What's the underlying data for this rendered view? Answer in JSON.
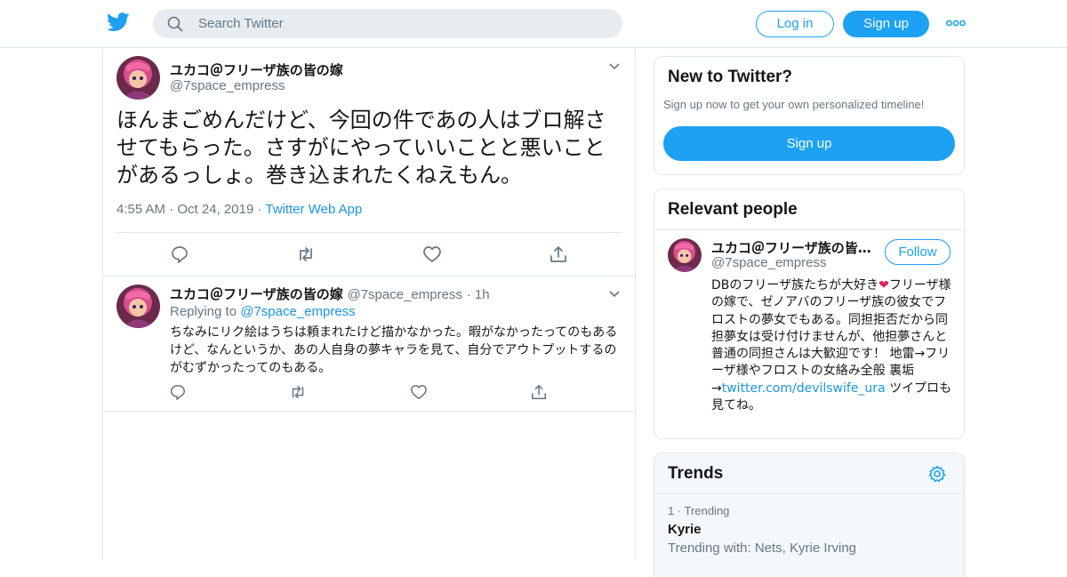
{
  "colors": {
    "accent": "#1da1f2",
    "link": "#1b95e0",
    "secondary_text": "#657786",
    "border": "#e1e8ed"
  },
  "header": {
    "search_placeholder": "Search Twitter",
    "login_label": "Log in",
    "signup_label": "Sign up"
  },
  "main_tweet": {
    "name": "ユカコ＠フリーザ族の皆の嫁",
    "handle": "@7space_empress",
    "text": "ほんまごめんだけど、今回の件であの人はブロ解させてもらった。さすがにやっていいことと悪いことがあるっしょ。巻き込まれたくねえもん。",
    "time": "4:55 AM",
    "date": "Oct 24, 2019",
    "source": "Twitter Web App"
  },
  "reply_tweet": {
    "name": "ユカコ＠フリーザ族の皆の嫁",
    "handle": "@7space_empress",
    "time": "1h",
    "replying_label": "Replying to",
    "replying_to": "@7space_empress",
    "text": "ちなみにリク絵はうちは頼まれたけど描かなかった。暇がなかったってのもあるけど、なんというか、あの人自身の夢キャラを見て、自分でアウトプットするのがむずかったってのもある。"
  },
  "new_to_twitter": {
    "title": "New to Twitter?",
    "subtitle": "Sign up now to get your own personalized timeline!",
    "button": "Sign up"
  },
  "relevant_people": {
    "title": "Relevant people",
    "person": {
      "name": "ユカコ＠フリーザ族の皆の嫁",
      "handle": "@7space_empress",
      "follow_label": "Follow",
      "bio_start": "DBのフリーザ族たちが大好き",
      "bio_heart": "❤",
      "bio_mid": "フリーザ様の嫁で、ゼノアバのフリーザ族の彼女でフロストの夢女でもある。同担拒否だから同担夢女は受け付けませんが、他担夢さんと普通の同担さんは大歓迎です！ 地雷→フリーザ様やフロストの女絡み全般 裏垢→",
      "bio_link": "twitter.com/devilswife_ura",
      "bio_end": " ツイプロも見てね。"
    }
  },
  "trends": {
    "title": "Trends",
    "items": [
      {
        "rank": "1",
        "label": "Trending",
        "name": "Kyrie",
        "with": "Trending with: Nets, Kyrie Irving"
      }
    ]
  },
  "icons": [
    "twitter-bird-icon",
    "search-icon",
    "more-dots-icon",
    "chevron-down-icon",
    "reply-icon",
    "retweet-icon",
    "like-icon",
    "share-icon",
    "gear-icon"
  ]
}
